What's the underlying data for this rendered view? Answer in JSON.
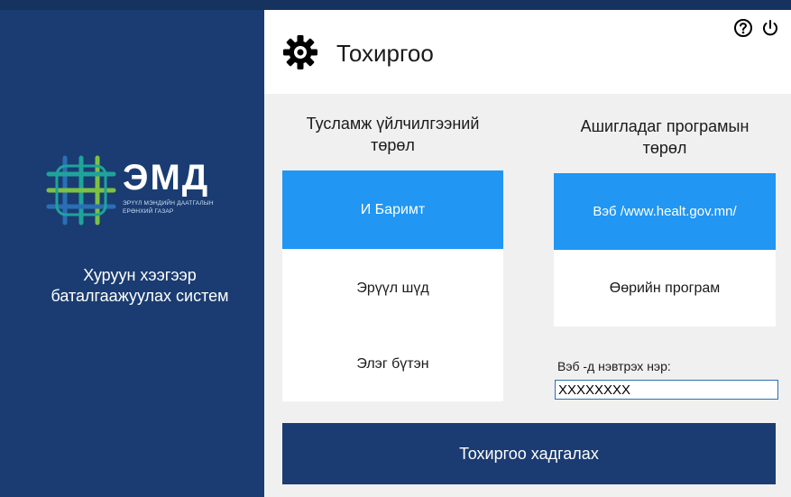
{
  "brand": {
    "name": "ЭМД",
    "subtitle_line1": "ЭРҮҮЛ МЭНДИЙН ДААТГАЛЫН",
    "subtitle_line2": "ЕРӨНХИЙ ГАЗАР",
    "system_title_line1": "Хуруун хээгээр",
    "system_title_line2": "баталгаажуулах систем",
    "colors": {
      "sidebar": "#1a3c72",
      "logo_teal": "#1fa39a",
      "logo_green": "#7cc242",
      "logo_blue": "#2a6fb4"
    }
  },
  "dialog": {
    "title": "Тохиргоо",
    "icons": {
      "settings": "gear-icon",
      "help": "help-icon",
      "power": "power-icon"
    }
  },
  "service_type": {
    "heading_line1": "Тусламж үйлчилгээний",
    "heading_line2": "төрөл",
    "options": [
      {
        "label": "И Баримт",
        "selected": true
      },
      {
        "label": "Эрүүл шүд",
        "selected": false
      },
      {
        "label": "Элэг бүтэн",
        "selected": false
      }
    ]
  },
  "program_type": {
    "heading_line1": "Ашигладаг програмын",
    "heading_line2": "төрөл",
    "options": [
      {
        "label": "Вэб /www.healt.gov.mn/",
        "selected": true
      },
      {
        "label": "Өөрийн програм",
        "selected": false
      }
    ]
  },
  "login": {
    "label": "Вэб -д нэвтрэх нэр:",
    "value": "XXXXXXXX"
  },
  "save_button": {
    "label": "Тохиргоо хадгалах"
  },
  "colors": {
    "accent": "#2196f3",
    "primary": "#1a3c72",
    "panel_bg": "#f0f0f0"
  }
}
